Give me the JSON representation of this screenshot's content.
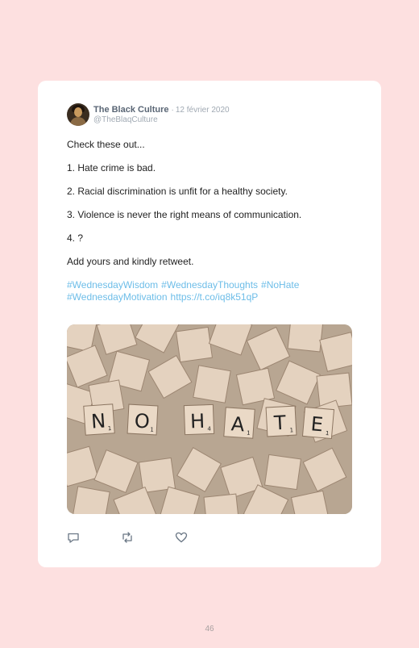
{
  "tweet": {
    "display_name": "The Black Culture",
    "separator": "·",
    "date": "12 février 2020",
    "handle": "@TheBlaqCulture",
    "lines": [
      "Check these out...",
      "1. Hate crime is bad.",
      "2. Racial discrimination is unfit for a healthy society.",
      "3. Violence is never the right means of communication.",
      "4. ?",
      "Add yours and kindly retweet."
    ],
    "hashtags": [
      "#WednesdayWisdom",
      "#WednesdayThoughts",
      "#NoHate",
      "#WednesdayMotivation"
    ],
    "link": "https://t.co/iq8k51qP",
    "image_tiles": [
      {
        "letter": "N",
        "points": "1"
      },
      {
        "letter": "O",
        "points": "1"
      },
      {
        "letter": "H",
        "points": "4"
      },
      {
        "letter": "A",
        "points": "1"
      },
      {
        "letter": "T",
        "points": "1"
      },
      {
        "letter": "E",
        "points": "1"
      }
    ],
    "actions": [
      "reply-icon",
      "retweet-icon",
      "like-icon"
    ]
  },
  "page_number": "46",
  "colors": {
    "page_background": "#fde0e0",
    "card": "#ffffff",
    "link": "#6dbde8",
    "muted": "#a0a9b3"
  }
}
